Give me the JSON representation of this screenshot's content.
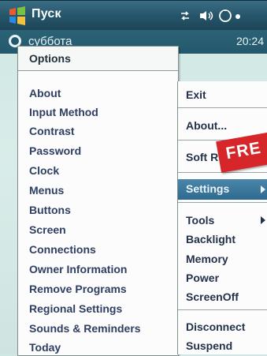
{
  "taskbar": {
    "start_label": "Пуск",
    "day": "суббота",
    "time": "20:24"
  },
  "options_menu": {
    "header": "Options",
    "items": [
      "About",
      "Input Method",
      "Contrast",
      "Password",
      "Clock",
      "Menus",
      "Buttons",
      "Screen",
      "Connections",
      "Owner Information",
      "Remove Programs",
      "Regional Settings",
      "Sounds & Reminders",
      "Today"
    ]
  },
  "side_menu": {
    "items": [
      "Exit",
      "About...",
      "Soft R",
      "Settings",
      "Tools",
      "Backlight",
      "Memory",
      "Power",
      "ScreenOff",
      "Disconnect",
      "Suspend"
    ],
    "selected": "Settings"
  },
  "badge": {
    "text": "FRE",
    "color": "#d7262a"
  }
}
